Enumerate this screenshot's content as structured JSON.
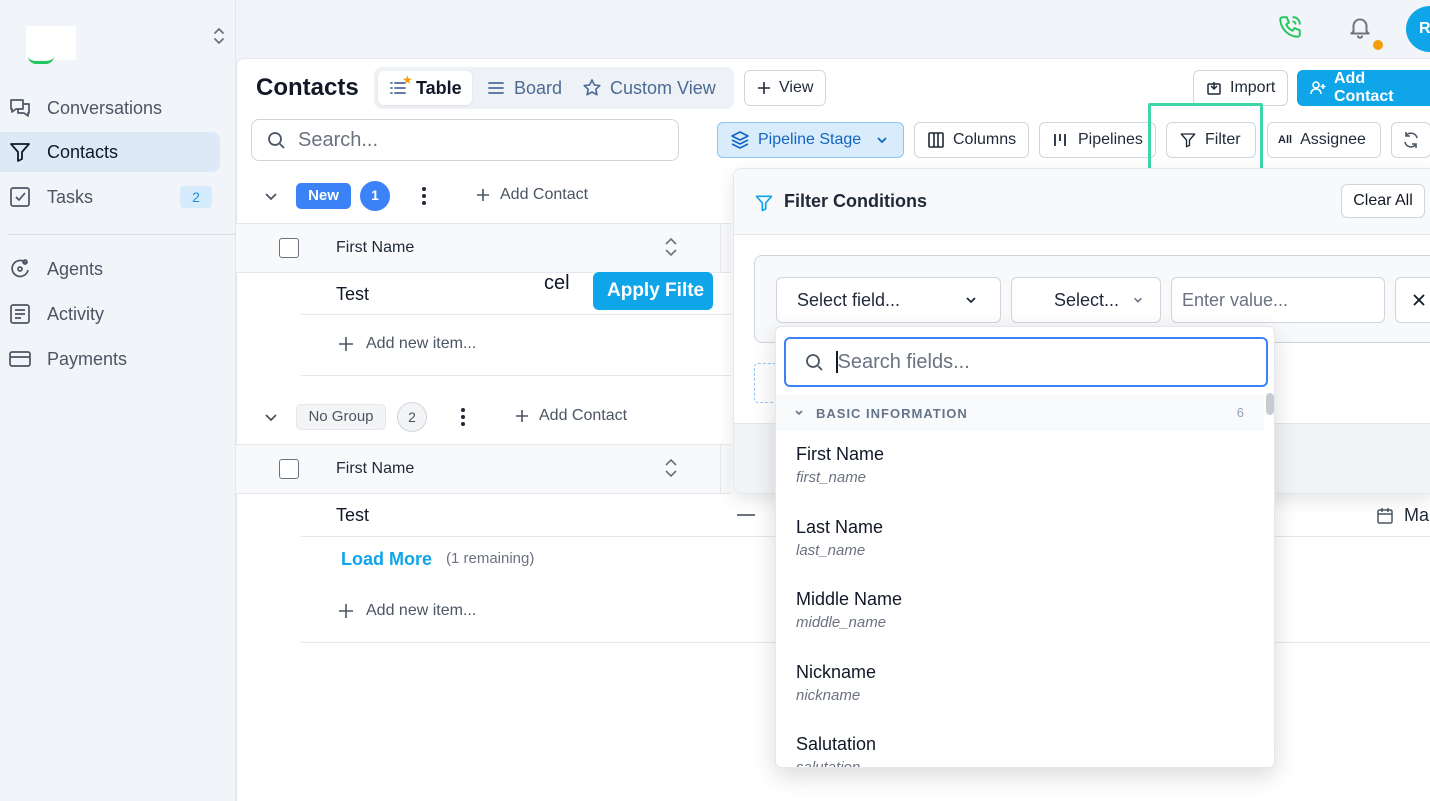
{
  "sidebar": {
    "items": [
      {
        "label": "Conversations",
        "icon": "chat-icon"
      },
      {
        "label": "Contacts",
        "icon": "filter-icon"
      },
      {
        "label": "Tasks",
        "icon": "checkbox-icon",
        "badge": "2"
      },
      {
        "label": "Agents",
        "icon": "agent-icon"
      },
      {
        "label": "Activity",
        "icon": "list-icon"
      },
      {
        "label": "Payments",
        "icon": "card-icon"
      }
    ]
  },
  "topbar": {
    "avatar_initial": "R"
  },
  "header": {
    "title": "Contacts",
    "tabs": [
      {
        "label": "Table",
        "icon": "list-icon"
      },
      {
        "label": "Board",
        "icon": "board-icon"
      },
      {
        "label": "Custom View",
        "icon": "star-icon"
      }
    ],
    "add_view_label": "View",
    "import_label": "Import",
    "add_contact_label": "Add Contact"
  },
  "toolbar": {
    "search_placeholder": "Search...",
    "pipeline_stage_label": "Pipeline Stage",
    "columns_label": "Columns",
    "pipelines_label": "Pipelines",
    "filter_label": "Filter",
    "assignee_badge": "All",
    "assignee_label": "Assignee"
  },
  "groups": [
    {
      "name": "New",
      "count": "1",
      "add_contact_label": "Add Contact",
      "column_header": "First Name",
      "rows": [
        "Test"
      ],
      "add_item_label": "Add new item..."
    },
    {
      "name": "No Group",
      "count": "2",
      "add_contact_label": "Add Contact",
      "column_header": "First Name",
      "rows": [
        "Test"
      ],
      "load_more_label": "Load More",
      "remaining_label": "(1 remaining)",
      "add_item_label": "Add new item...",
      "row_dash": "—",
      "row_date_partial": "Ma"
    }
  ],
  "filter_panel": {
    "title": "Filter Conditions",
    "clear_all_label": "Clear All",
    "field_select_label": "Select field...",
    "operator_select_label": "Select...",
    "value_placeholder": "Enter value...",
    "cancel_label": "cel",
    "apply_label": "Apply Filte"
  },
  "field_dropdown": {
    "search_placeholder": "Search fields...",
    "section_label": "BASIC INFORMATION",
    "section_count": "6",
    "fields": [
      {
        "label": "First Name",
        "key": "first_name"
      },
      {
        "label": "Last Name",
        "key": "last_name"
      },
      {
        "label": "Middle Name",
        "key": "middle_name"
      },
      {
        "label": "Nickname",
        "key": "nickname"
      },
      {
        "label": "Salutation",
        "key": "salutation"
      }
    ]
  },
  "colors": {
    "accent": "#0ea5e9",
    "highlight_border": "#3dd6a9",
    "notification_dot": "#f59e0b",
    "phone_icon": "#22c55e"
  }
}
